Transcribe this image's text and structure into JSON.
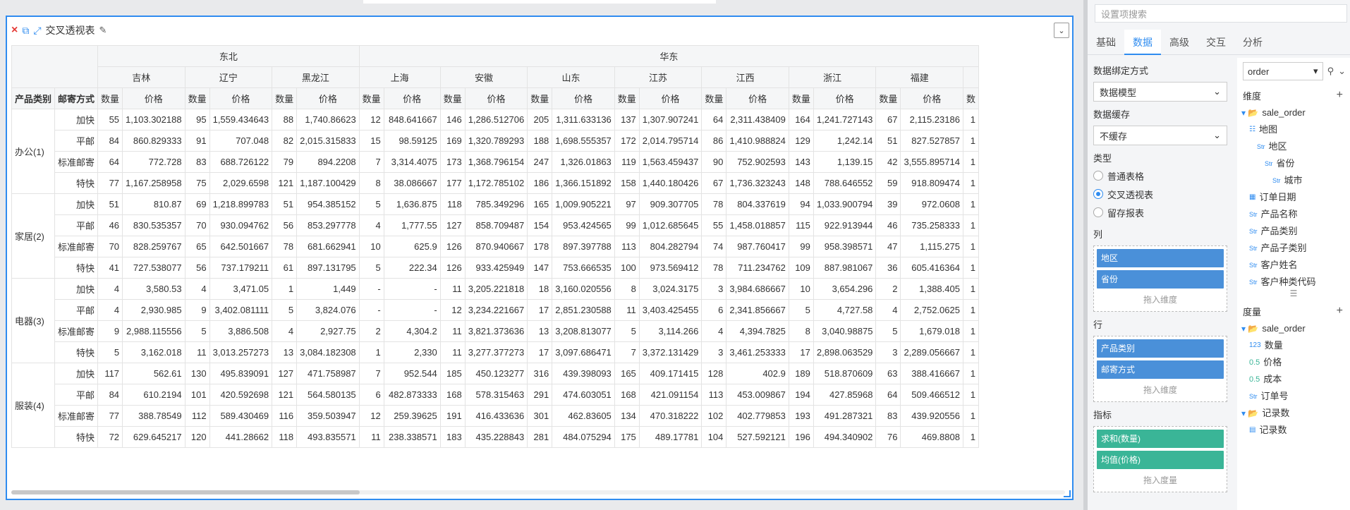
{
  "widget": {
    "title": "交叉透视表",
    "close_icon": "×",
    "copy_icon": "⧉",
    "expand_icon": "⤢",
    "edit_icon": "✎",
    "dropdown_icon": "⌄"
  },
  "pivot": {
    "corner_labels": [
      "产品类别",
      "邮寄方式"
    ],
    "regions": [
      {
        "name": "东北",
        "span": 6
      },
      {
        "name": "华东",
        "span": 15
      }
    ],
    "provinces": [
      "吉林",
      "辽宁",
      "黑龙江",
      "上海",
      "安徽",
      "山东",
      "江苏",
      "江西",
      "浙江",
      "福建"
    ],
    "measure_labels": [
      "数量",
      "价格"
    ],
    "trailing_measure": "数",
    "categories": [
      {
        "name": "办公(1)",
        "rows": [
          {
            "ship": "加快",
            "cells": [
              "55",
              "1,103.302188",
              "95",
              "1,559.434643",
              "88",
              "1,740.86623",
              "12",
              "848.641667",
              "146",
              "1,286.512706",
              "205",
              "1,311.633136",
              "137",
              "1,307.907241",
              "64",
              "2,311.438409",
              "164",
              "1,241.727143",
              "67",
              "2,115.23186"
            ],
            "trail": "1"
          },
          {
            "ship": "平邮",
            "cells": [
              "84",
              "860.829333",
              "91",
              "707.048",
              "82",
              "2,015.315833",
              "15",
              "98.59125",
              "169",
              "1,320.789293",
              "188",
              "1,698.555357",
              "172",
              "2,014.795714",
              "86",
              "1,410.988824",
              "129",
              "1,242.14",
              "51",
              "827.527857"
            ],
            "trail": "1"
          },
          {
            "ship": "标准邮寄",
            "cells": [
              "64",
              "772.728",
              "83",
              "688.726122",
              "79",
              "894.2208",
              "7",
              "3,314.4075",
              "173",
              "1,368.796154",
              "247",
              "1,326.01863",
              "119",
              "1,563.459437",
              "90",
              "752.902593",
              "143",
              "1,139.15",
              "42",
              "3,555.895714"
            ],
            "trail": "1"
          },
          {
            "ship": "特快",
            "cells": [
              "77",
              "1,167.258958",
              "75",
              "2,029.6598",
              "121",
              "1,187.100429",
              "8",
              "38.086667",
              "177",
              "1,172.785102",
              "186",
              "1,366.151892",
              "158",
              "1,440.180426",
              "67",
              "1,736.323243",
              "148",
              "788.646552",
              "59",
              "918.809474"
            ],
            "trail": "1"
          }
        ]
      },
      {
        "name": "家居(2)",
        "rows": [
          {
            "ship": "加快",
            "cells": [
              "51",
              "810.87",
              "69",
              "1,218.899783",
              "51",
              "954.385152",
              "5",
              "1,636.875",
              "118",
              "785.349296",
              "165",
              "1,009.905221",
              "97",
              "909.307705",
              "78",
              "804.337619",
              "94",
              "1,033.900794",
              "39",
              "972.0608"
            ],
            "trail": "1"
          },
          {
            "ship": "平邮",
            "cells": [
              "46",
              "830.535357",
              "70",
              "930.094762",
              "56",
              "853.297778",
              "4",
              "1,777.55",
              "127",
              "858.709487",
              "154",
              "953.424565",
              "99",
              "1,012.685645",
              "55",
              "1,458.018857",
              "115",
              "922.913944",
              "46",
              "735.258333"
            ],
            "trail": "1"
          },
          {
            "ship": "标准邮寄",
            "cells": [
              "70",
              "828.259767",
              "65",
              "642.501667",
              "78",
              "681.662941",
              "10",
              "625.9",
              "126",
              "870.940667",
              "178",
              "897.397788",
              "113",
              "804.282794",
              "74",
              "987.760417",
              "99",
              "958.398571",
              "47",
              "1,115.275"
            ],
            "trail": "1"
          },
          {
            "ship": "特快",
            "cells": [
              "41",
              "727.538077",
              "56",
              "737.179211",
              "61",
              "897.131795",
              "5",
              "222.34",
              "126",
              "933.425949",
              "147",
              "753.666535",
              "100",
              "973.569412",
              "78",
              "711.234762",
              "109",
              "887.981067",
              "36",
              "605.416364"
            ],
            "trail": "1"
          }
        ]
      },
      {
        "name": "电器(3)",
        "rows": [
          {
            "ship": "加快",
            "cells": [
              "4",
              "3,580.53",
              "4",
              "3,471.05",
              "1",
              "1,449",
              "-",
              "-",
              "11",
              "3,205.221818",
              "18",
              "3,160.020556",
              "8",
              "3,024.3175",
              "3",
              "3,984.686667",
              "10",
              "3,654.296",
              "2",
              "1,388.405"
            ],
            "trail": "1"
          },
          {
            "ship": "平邮",
            "cells": [
              "4",
              "2,930.985",
              "9",
              "3,402.081111",
              "5",
              "3,824.076",
              "-",
              "-",
              "12",
              "3,234.221667",
              "17",
              "2,851.230588",
              "11",
              "3,403.425455",
              "6",
              "2,341.856667",
              "5",
              "4,727.58",
              "4",
              "2,752.0625"
            ],
            "trail": "1"
          },
          {
            "ship": "标准邮寄",
            "cells": [
              "9",
              "2,988.115556",
              "5",
              "3,886.508",
              "4",
              "2,927.75",
              "2",
              "4,304.2",
              "11",
              "3,821.373636",
              "13",
              "3,208.813077",
              "5",
              "3,114.266",
              "4",
              "4,394.7825",
              "8",
              "3,040.98875",
              "5",
              "1,679.018"
            ],
            "trail": "1"
          },
          {
            "ship": "特快",
            "cells": [
              "5",
              "3,162.018",
              "11",
              "3,013.257273",
              "13",
              "3,084.182308",
              "1",
              "2,330",
              "11",
              "3,277.377273",
              "17",
              "3,097.686471",
              "7",
              "3,372.131429",
              "3",
              "3,461.253333",
              "17",
              "2,898.063529",
              "3",
              "2,289.056667"
            ],
            "trail": "1"
          }
        ]
      },
      {
        "name": "服装(4)",
        "rows": [
          {
            "ship": "加快",
            "cells": [
              "117",
              "562.61",
              "130",
              "495.839091",
              "127",
              "471.758987",
              "7",
              "952.544",
              "185",
              "450.123277",
              "316",
              "439.398093",
              "165",
              "409.171415",
              "128",
              "402.9",
              "189",
              "518.870609",
              "63",
              "388.416667"
            ],
            "trail": "1"
          },
          {
            "ship": "平邮",
            "cells": [
              "84",
              "610.2194",
              "101",
              "420.592698",
              "121",
              "564.580135",
              "6",
              "482.873333",
              "168",
              "578.315463",
              "291",
              "474.603051",
              "168",
              "421.091154",
              "113",
              "453.009867",
              "194",
              "427.85968",
              "64",
              "509.466512"
            ],
            "trail": "1"
          },
          {
            "ship": "标准邮寄",
            "cells": [
              "77",
              "388.78549",
              "112",
              "589.430469",
              "116",
              "359.503947",
              "12",
              "259.39625",
              "191",
              "416.433636",
              "301",
              "462.83605",
              "134",
              "470.318222",
              "102",
              "402.779853",
              "193",
              "491.287321",
              "83",
              "439.920556"
            ],
            "trail": "1"
          },
          {
            "ship": "特快",
            "cells": [
              "72",
              "629.645217",
              "120",
              "441.28662",
              "118",
              "493.835571",
              "11",
              "238.338571",
              "183",
              "435.228843",
              "281",
              "484.075294",
              "175",
              "489.17781",
              "104",
              "527.592121",
              "196",
              "494.340902",
              "76",
              "469.8808"
            ],
            "trail": "1"
          }
        ]
      }
    ]
  },
  "panel": {
    "search_placeholder": "设置项搜索",
    "tabs": [
      "基础",
      "数据",
      "高级",
      "交互",
      "分析"
    ],
    "active_tab": "数据",
    "binding_label": "数据绑定方式",
    "binding_value": "数据模型",
    "cache_label": "数据缓存",
    "cache_value": "不缓存",
    "type_label": "类型",
    "type_options": [
      {
        "label": "普通表格",
        "checked": false
      },
      {
        "label": "交叉透视表",
        "checked": true
      },
      {
        "label": "留存报表",
        "checked": false
      }
    ],
    "columns_label": "列",
    "columns_chips": [
      "地区",
      "省份"
    ],
    "rows_label": "行",
    "rows_chips": [
      "产品类别",
      "邮寄方式"
    ],
    "drop_dimension": "拖入维度",
    "measures_label": "指标",
    "measures_chips": [
      "求和(数量)",
      "均值(价格)"
    ],
    "drop_measure": "拖入度量",
    "model": "order",
    "dimension_header": "维度",
    "dimension_tree": [
      {
        "indent": 0,
        "icon": "folder",
        "label": "sale_order"
      },
      {
        "indent": 1,
        "icon": "hier",
        "label": "地图"
      },
      {
        "indent": 2,
        "icon": "Str",
        "label": "地区"
      },
      {
        "indent": 3,
        "icon": "Str",
        "label": "省份"
      },
      {
        "indent": 4,
        "icon": "Str",
        "label": "城市"
      },
      {
        "indent": 1,
        "icon": "date",
        "label": "订单日期"
      },
      {
        "indent": 1,
        "icon": "Str",
        "label": "产品名称"
      },
      {
        "indent": 1,
        "icon": "Str",
        "label": "产品类别"
      },
      {
        "indent": 1,
        "icon": "Str",
        "label": "产品子类别"
      },
      {
        "indent": 1,
        "icon": "Str",
        "label": "客户姓名"
      },
      {
        "indent": 1,
        "icon": "Str",
        "label": "客户种类代码"
      }
    ],
    "measure_header": "度量",
    "measure_tree": [
      {
        "indent": 0,
        "icon": "folder",
        "label": "sale_order"
      },
      {
        "indent": 1,
        "icon": "123",
        "label": "数量"
      },
      {
        "indent": 1,
        "icon": "0.5",
        "label": "价格"
      },
      {
        "indent": 1,
        "icon": "0.5",
        "label": "成本"
      },
      {
        "indent": 1,
        "icon": "Str",
        "label": "订单号"
      },
      {
        "indent": 0,
        "icon": "folder",
        "label": "记录数"
      },
      {
        "indent": 1,
        "icon": "rec",
        "label": "记录数"
      }
    ]
  }
}
